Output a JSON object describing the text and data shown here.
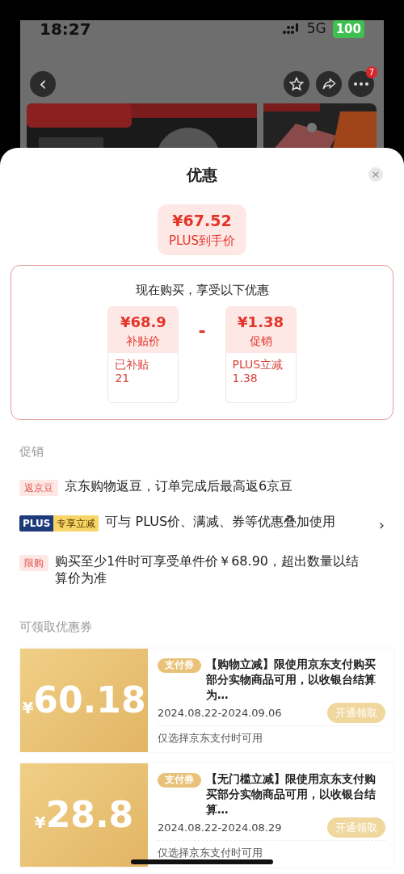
{
  "status_bar": {
    "time": "18:27",
    "network": "5G",
    "battery": "100"
  },
  "nav": {
    "back": "‹",
    "badge": "7"
  },
  "sheet": {
    "title": "优惠",
    "close": "×",
    "final_price": {
      "amount": "¥67.52",
      "label": "PLUS到手价"
    },
    "breakdown": {
      "heading": "现在购买，享受以下优惠",
      "operator": "-",
      "items": [
        {
          "amount": "¥68.9",
          "label": "补贴价",
          "detail": "已补贴\n21"
        },
        {
          "amount": "¥1.38",
          "label": "促销",
          "detail": "PLUS立减\n1.38"
        }
      ]
    },
    "promotions": {
      "title": "促销",
      "items": [
        {
          "kind": "tag",
          "tag": "返京豆",
          "text": "京东购物返豆，订单完成后最高返6京豆"
        },
        {
          "kind": "plus",
          "tag": "PLUS",
          "tag2": "专享立减",
          "text": "可与 PLUS价、满减、券等优惠叠加使用",
          "arrow": "›"
        },
        {
          "kind": "tag",
          "tag": "限购",
          "text": "购买至少1件时可享受单件价￥68.90，超出数量以结算价为准"
        }
      ]
    },
    "coupons": {
      "title": "可领取优惠券",
      "items": [
        {
          "currency": "¥",
          "amount": "60.18",
          "tag": "支付券",
          "title": "【购物立减】限使用京东支付购买部分实物商品可用，以收银台结算为…",
          "date": "2024.08.22-2024.09.06",
          "button": "开通领取",
          "note": "仅选择京东支付时可用"
        },
        {
          "currency": "¥",
          "amount": "28.8",
          "tag": "支付券",
          "title": "【无门槛立减】限使用京东支付购买部分实物商品可用，以收银台结算…",
          "date": "2024.08.22-2024.08.29",
          "button": "开通领取",
          "note": "仅选择京东支付时可用"
        }
      ]
    }
  }
}
